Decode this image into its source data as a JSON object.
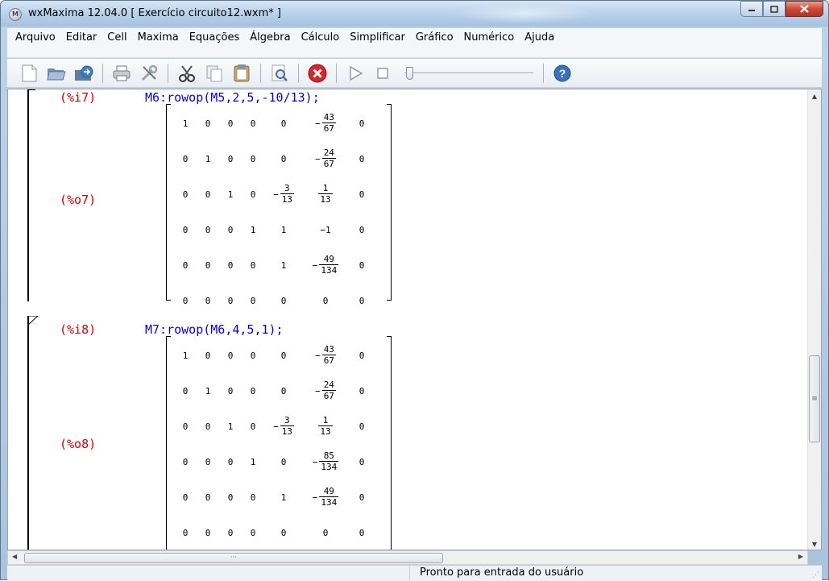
{
  "window": {
    "title": "wxMaxima 12.04.0  [ Exercício circuito12.wxm* ]",
    "app_icon_text": "M"
  },
  "menu": [
    "Arquivo",
    "Editar",
    "Cell",
    "Maxima",
    "Equações",
    "Álgebra",
    "Cálculo",
    "Simplificar",
    "Gráfico",
    "Numérico",
    "Ajuda"
  ],
  "toolbar": {
    "icons": [
      "new-file-icon",
      "open-folder-icon",
      "save-icon",
      "print-icon",
      "preferences-icon",
      "cut-icon",
      "copy-icon",
      "paste-icon",
      "find-icon",
      "interrupt-icon",
      "play-icon",
      "stop-icon",
      "animation-slider",
      "help-icon"
    ]
  },
  "cells": [
    {
      "input_label": "(%i7)",
      "input_code": "M6:rowop(M5,2,5,-10/13);",
      "output_label": "(%o7)",
      "matrix": [
        [
          "1",
          "0",
          "0",
          "0",
          "0",
          {
            "neg": true,
            "num": "43",
            "den": "67"
          },
          "0"
        ],
        [
          "0",
          "1",
          "0",
          "0",
          "0",
          {
            "neg": true,
            "num": "24",
            "den": "67"
          },
          "0"
        ],
        [
          "0",
          "0",
          "1",
          "0",
          {
            "neg": true,
            "num": "3",
            "den": "13"
          },
          {
            "neg": false,
            "num": "1",
            "den": "13"
          },
          "0"
        ],
        [
          "0",
          "0",
          "0",
          "1",
          "1",
          "−1",
          "0"
        ],
        [
          "0",
          "0",
          "0",
          "0",
          "1",
          {
            "neg": true,
            "num": "49",
            "den": "134"
          },
          "0"
        ],
        [
          "0",
          "0",
          "0",
          "0",
          "0",
          "0",
          "0"
        ]
      ]
    },
    {
      "input_label": "(%i8)",
      "input_code": "M7:rowop(M6,4,5,1);",
      "output_label": "(%o8)",
      "matrix": [
        [
          "1",
          "0",
          "0",
          "0",
          "0",
          {
            "neg": true,
            "num": "43",
            "den": "67"
          },
          "0"
        ],
        [
          "0",
          "1",
          "0",
          "0",
          "0",
          {
            "neg": true,
            "num": "24",
            "den": "67"
          },
          "0"
        ],
        [
          "0",
          "0",
          "1",
          "0",
          {
            "neg": true,
            "num": "3",
            "den": "13"
          },
          {
            "neg": false,
            "num": "1",
            "den": "13"
          },
          "0"
        ],
        [
          "0",
          "0",
          "0",
          "1",
          "0",
          {
            "neg": true,
            "num": "85",
            "den": "134"
          },
          "0"
        ],
        [
          "0",
          "0",
          "0",
          "0",
          "1",
          {
            "neg": true,
            "num": "49",
            "den": "134"
          },
          "0"
        ],
        [
          "0",
          "0",
          "0",
          "0",
          "0",
          "0",
          "0"
        ]
      ]
    }
  ],
  "scroll": {
    "grip": "≡",
    "hgrip": "···"
  },
  "status": {
    "text": "Pronto para entrada do usuário"
  }
}
